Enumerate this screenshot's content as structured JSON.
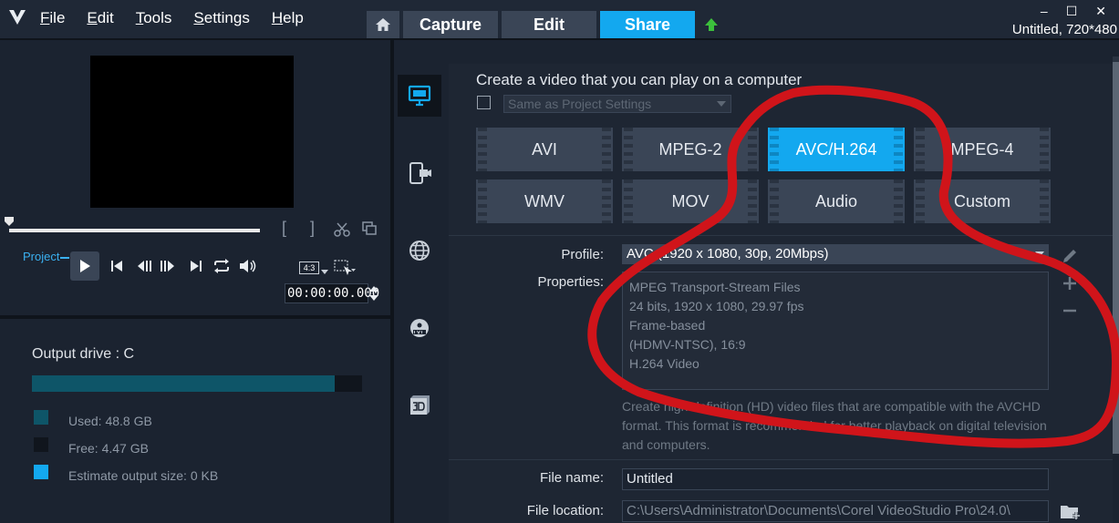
{
  "app": {
    "menu": [
      {
        "label": "File",
        "key": "F",
        "rest": "ile"
      },
      {
        "label": "Edit",
        "key": "E",
        "rest": "dit"
      },
      {
        "label": "Tools",
        "key": "T",
        "rest": "ools"
      },
      {
        "label": "Settings",
        "key": "S",
        "rest": "ettings"
      },
      {
        "label": "Help",
        "key": "H",
        "rest": "elp"
      }
    ],
    "tabs": {
      "capture": "Capture",
      "edit": "Edit",
      "share": "Share"
    },
    "project_info": "Untitled, 720*480",
    "window_controls": {
      "minimize": "–",
      "maximize": "☐",
      "close": "✕"
    }
  },
  "player": {
    "project_label": "Project",
    "mark_in": "[",
    "mark_out": "]",
    "aspect": "4:3",
    "timecode": "00:00:00.000"
  },
  "output": {
    "title": "Output drive : C",
    "used_fraction": 0.916,
    "used": "Used:  48.8 GB",
    "free": "Free:  4.47 GB",
    "estimate": "Estimate output size:  0 KB",
    "colors": {
      "used": "#0e5568",
      "free": "#10151d",
      "estimate": "#13a8ef"
    }
  },
  "share": {
    "heading": "Create a video that you can play on a computer",
    "same_as_project": "Same as Project Settings",
    "formats": [
      {
        "label": "AVI",
        "selected": false
      },
      {
        "label": "MPEG-2",
        "selected": false
      },
      {
        "label": "AVC/H.264",
        "selected": true
      },
      {
        "label": "MPEG-4",
        "selected": false
      },
      {
        "label": "WMV",
        "selected": false
      },
      {
        "label": "MOV",
        "selected": false
      },
      {
        "label": "Audio",
        "selected": false
      },
      {
        "label": "Custom",
        "selected": false
      }
    ],
    "profile_label": "Profile:",
    "profile_value": "AVC (1920 x 1080, 30p, 20Mbps)",
    "properties_label": "Properties:",
    "properties": [
      "MPEG Transport-Stream Files",
      "24 bits, 1920 x 1080, 29.97 fps",
      "Frame-based",
      "(HDMV-NTSC),  16:9",
      "H.264 Video"
    ],
    "description": "Create high-definition (HD) video files that are compatible with the AVCHD format. This format is recommended for better playback on digital television and computers.",
    "file_name_label": "File name:",
    "file_name": "Untitled",
    "file_location_label": "File location:",
    "file_location": "C:\\Users\\Administrator\\Documents\\Corel VideoStudio Pro\\24.0\\",
    "accent": "#13a8ef",
    "annotation_color": "#d0141a"
  }
}
